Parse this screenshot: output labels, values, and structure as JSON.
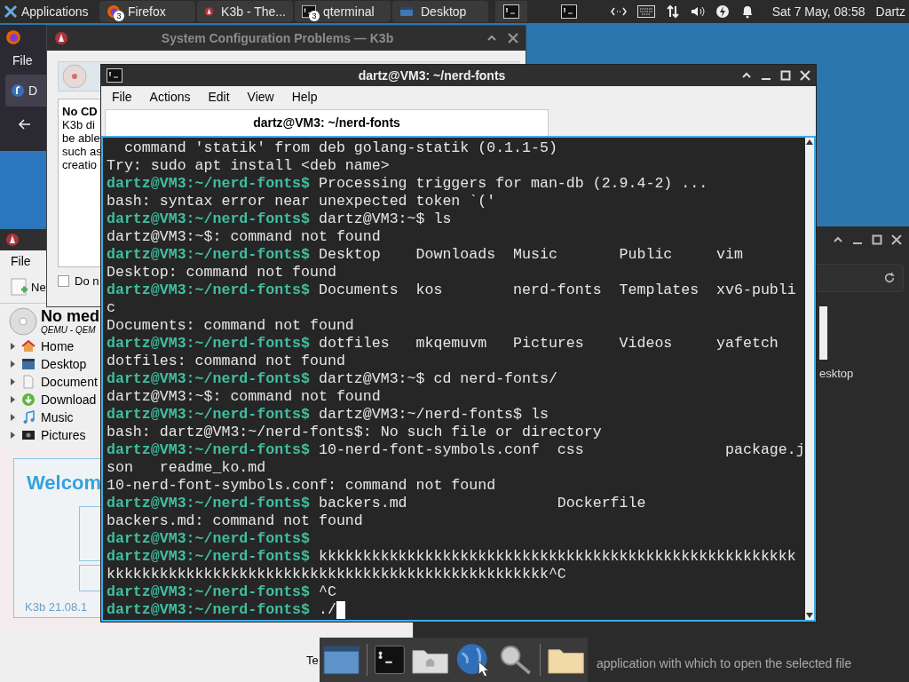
{
  "top_panel": {
    "applications": "Applications",
    "tasks": [
      {
        "label": "Firefox",
        "kind": "firefox",
        "badge": "3"
      },
      {
        "label": "K3b - The...",
        "kind": "k3b"
      },
      {
        "label": "qterminal",
        "kind": "terminal",
        "badge": "3"
      },
      {
        "label": "Desktop",
        "kind": "desktop"
      }
    ],
    "clock": "Sat 7 May, 08:58",
    "user": "Dartz"
  },
  "firefox_window": {
    "menu": "File",
    "tab": "D"
  },
  "k3b_dialog": {
    "title": "System Configuration Problems — K3b",
    "heading": "No CD",
    "body_lines": [
      "K3b di",
      "be able",
      "such as",
      "creatio"
    ],
    "checkbox": {
      "label": "Do n",
      "checked": false
    }
  },
  "k3b_window": {
    "menu": "File",
    "toolbar_button": "Ne",
    "device": {
      "title": "No med",
      "subtitle": "QEMU - QEM"
    },
    "tree": [
      {
        "label": "Home",
        "kind": "home",
        "expanded": false
      },
      {
        "label": "Desktop",
        "kind": "desktop",
        "expanded": false
      },
      {
        "label": "Document",
        "kind": "document",
        "expanded": false
      },
      {
        "label": "Download",
        "kind": "download",
        "expanded": false
      },
      {
        "label": "Music",
        "kind": "music",
        "expanded": false
      },
      {
        "label": "Pictures",
        "kind": "pictures",
        "expanded": false
      }
    ],
    "welcome": {
      "title": "Welcom",
      "version": "K3b 21.08.1"
    },
    "footer": "Te"
  },
  "file_window": {
    "item_label": "esktop",
    "status": "application with which to open the selected file"
  },
  "terminal": {
    "title": "dartz@VM3: ~/nerd-fonts",
    "menu": [
      "File",
      "Actions",
      "Edit",
      "View",
      "Help"
    ],
    "tab": {
      "label": "dartz@VM3: ~/nerd-fonts",
      "selected": true
    },
    "cursor": true,
    "lines": [
      {
        "text": "  command 'statik' from deb golang-statik (0.1.1-5)"
      },
      {
        "text": "Try: sudo apt install <deb name>"
      },
      {
        "prompt": "dartz@VM3:~/nerd-fonts$",
        "text": " Processing triggers for man-db (2.9.4-2) ..."
      },
      {
        "text": "bash: syntax error near unexpected token `('"
      },
      {
        "prompt": "dartz@VM3:~/nerd-fonts$",
        "text": " dartz@VM3:~$ ls"
      },
      {
        "text": "dartz@VM3:~$: command not found"
      },
      {
        "prompt": "dartz@VM3:~/nerd-fonts$",
        "text": " Desktop    Downloads  Music       Public     vim"
      },
      {
        "text": "Desktop: command not found"
      },
      {
        "prompt": "dartz@VM3:~/nerd-fonts$",
        "text": " Documents  kos        nerd-fonts  Templates  xv6-publi"
      },
      {
        "text": "c"
      },
      {
        "text": "Documents: command not found"
      },
      {
        "prompt": "dartz@VM3:~/nerd-fonts$",
        "text": " dotfiles   mkqemuvm   Pictures    Videos     yafetch"
      },
      {
        "text": "dotfiles: command not found"
      },
      {
        "prompt": "dartz@VM3:~/nerd-fonts$",
        "text": " dartz@VM3:~$ cd nerd-fonts/"
      },
      {
        "text": "dartz@VM3:~$: command not found"
      },
      {
        "prompt": "dartz@VM3:~/nerd-fonts$",
        "text": " dartz@VM3:~/nerd-fonts$ ls"
      },
      {
        "text": "bash: dartz@VM3:~/nerd-fonts$: No such file or directory"
      },
      {
        "prompt": "dartz@VM3:~/nerd-fonts$",
        "text": " 10-nerd-font-symbols.conf  css                package.j"
      },
      {
        "text": "son   readme_ko.md"
      },
      {
        "text": "10-nerd-font-symbols.conf: command not found"
      },
      {
        "prompt": "dartz@VM3:~/nerd-fonts$",
        "text": " backers.md                 Dockerfile"
      },
      {
        "text": "backers.md: command not found"
      },
      {
        "prompt": "dartz@VM3:~/nerd-fonts$"
      },
      {
        "prompt": "dartz@VM3:~/nerd-fonts$",
        "text": " kkkkkkkkkkkkkkkkkkkkkkkkkkkkkkkkkkkkkkkkkkkkkkkkkkkkkk"
      },
      {
        "text": "kkkkkkkkkkkkkkkkkkkkkkkkkkkkkkkkkkkkkkkkkkkkkkkkkk^C"
      },
      {
        "prompt": "dartz@VM3:~/nerd-fonts$",
        "text": " ^C"
      },
      {
        "prompt": "dartz@VM3:~/nerd-fonts$",
        "text": " ./"
      }
    ]
  }
}
